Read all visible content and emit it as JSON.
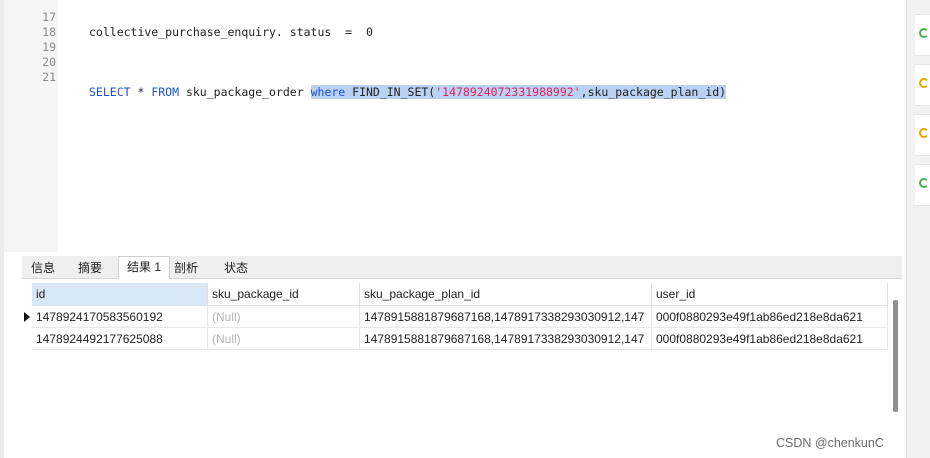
{
  "editor": {
    "lines": [
      {
        "num": "17",
        "text": "collective_purchase_enquiry. status  =  0"
      },
      {
        "num": "18",
        "text": ""
      },
      {
        "num": "19",
        "text": ""
      },
      {
        "num": "20",
        "text": ""
      },
      {
        "num": "21",
        "kw1": "SELECT",
        "star": " * ",
        "kw2": "FROM",
        "table": " sku_package_order ",
        "kw3": "where",
        "fn": " FIND_IN_SET(",
        "str": "'1478924072331988992'",
        "rest": ",sku_package_plan_id)"
      }
    ]
  },
  "result_tabs": [
    "信息",
    "摘要",
    "结果 1",
    "剖析",
    "状态"
  ],
  "grid": {
    "columns": [
      "id",
      "sku_package_id",
      "sku_package_plan_id",
      "user_id"
    ],
    "rows": [
      [
        "1478924170583560192",
        "(Null)",
        "1478915881879687168,1478917338293030912,147",
        "000f0880293e49f1ab86ed218e8da621"
      ],
      [
        "1478924492177625088",
        "(Null)",
        "1478915881879687168,1478917338293030912,147",
        "000f0880293e49f1ab86ed218e8da621"
      ]
    ]
  },
  "watermark": "CSDN @chenkunC"
}
